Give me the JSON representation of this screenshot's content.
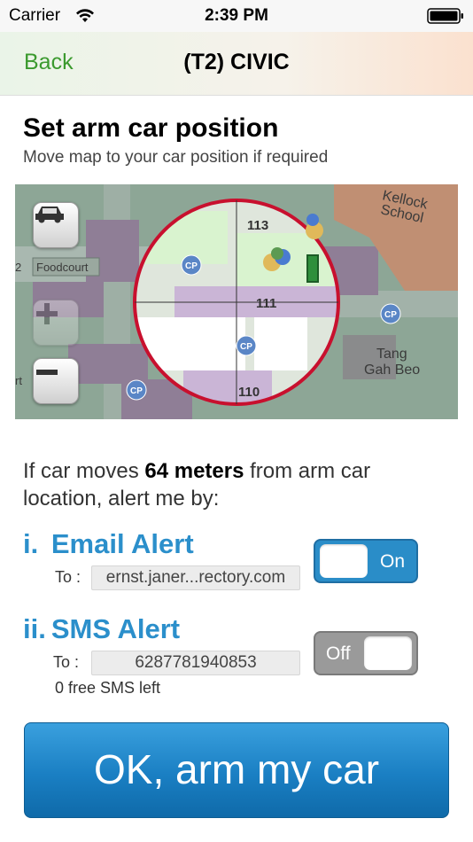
{
  "status_bar": {
    "carrier": "Carrier",
    "time": "2:39 PM"
  },
  "nav": {
    "back_label": "Back",
    "title": "(T2) CIVIC"
  },
  "page": {
    "heading": "Set arm car position",
    "subheading": "Move map to your car position if required"
  },
  "map": {
    "labels": {
      "foodcourt": "Foodcourt",
      "school": "Kellock School",
      "school_line1": "Kellock",
      "school_line2": "School",
      "tang": "Tang",
      "gah_beo": "Gah Beo",
      "b113": "113",
      "b111": "111",
      "b110": "110",
      "cp": "CP",
      "left_2": "2",
      "left_rt": "rt"
    },
    "icons": [
      "car-icon",
      "zoom-in-icon",
      "zoom-out-icon"
    ]
  },
  "alert": {
    "prefix": "If car moves ",
    "distance": "64 meters",
    "suffix": " from arm car location, alert me by:"
  },
  "email": {
    "index": "i.",
    "label": "Email Alert",
    "to_label": "To :",
    "value": "ernst.janer...rectory.com",
    "toggle_text": "On",
    "enabled": true
  },
  "sms": {
    "index": "ii.",
    "label": "SMS Alert",
    "to_label": "To :",
    "value": "6287781940853",
    "free_left": "0 free SMS left",
    "toggle_text": "Off",
    "enabled": false
  },
  "ok_button": {
    "label": "OK, arm my car"
  },
  "colors": {
    "accent_blue": "#2b8fcb",
    "back_green": "#3b9a2e",
    "circle_red": "#c8102e"
  }
}
